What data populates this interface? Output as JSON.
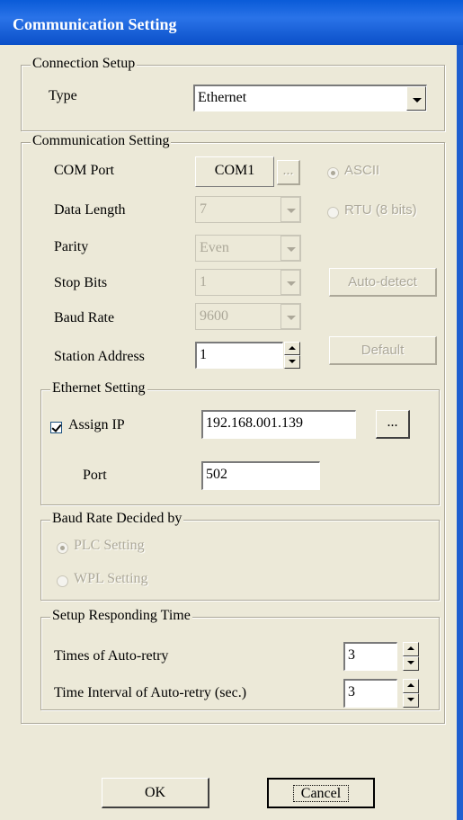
{
  "window": {
    "title": "Communication Setting"
  },
  "connection_setup": {
    "legend": "Connection Setup",
    "type_label": "Type",
    "type_value": "Ethernet"
  },
  "communication_setting": {
    "legend": "Communication Setting",
    "com_port_label": "COM Port",
    "com_port_value": "COM1",
    "browse_label": "...",
    "ascii_label": "ASCII",
    "rtu_label": "RTU (8 bits)",
    "data_length_label": "Data Length",
    "data_length_value": "7",
    "parity_label": "Parity",
    "parity_value": "Even",
    "stop_bits_label": "Stop Bits",
    "stop_bits_value": "1",
    "auto_detect_label": "Auto-detect",
    "baud_rate_label": "Baud Rate",
    "baud_rate_value": "9600",
    "station_address_label": "Station Address",
    "station_address_value": "1",
    "default_label": "Default"
  },
  "ethernet_setting": {
    "legend": "Ethernet Setting",
    "assign_ip_label": "Assign IP",
    "assign_ip_checked": true,
    "ip_value": "192.168.001.139",
    "ip_browse_label": "...",
    "port_label": "Port",
    "port_value": "502"
  },
  "baud_rate_decided": {
    "legend": "Baud Rate Decided by",
    "plc_label": "PLC Setting",
    "wpl_label": "WPL Setting"
  },
  "responding_time": {
    "legend": "Setup Responding Time",
    "retry_label": "Times of Auto-retry",
    "retry_value": "3",
    "interval_label": "Time Interval of Auto-retry (sec.)",
    "interval_value": "3"
  },
  "buttons": {
    "ok": "OK",
    "cancel": "Cancel"
  },
  "colors": {
    "titlebar": "#0a5bd8",
    "dialog_bg": "#ece9d8",
    "disabled_text": "#aca899"
  }
}
